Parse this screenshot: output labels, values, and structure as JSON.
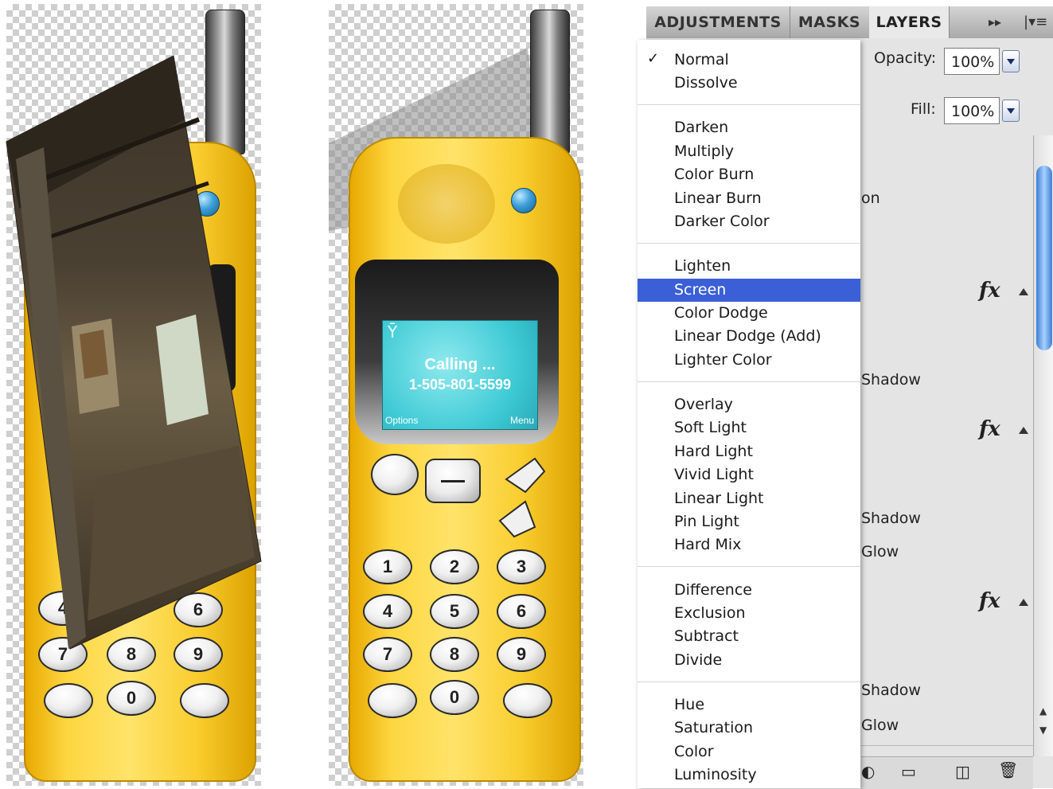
{
  "phone2": {
    "screen_status": "Calling ...",
    "screen_number": "1-505-801-5599",
    "softkey_left": "Options",
    "softkey_right": "Menu"
  },
  "keypad_labels": [
    "1",
    "2",
    "3",
    "4",
    "5",
    "6",
    "7",
    "8",
    "9",
    "0"
  ],
  "panel": {
    "tabs": [
      {
        "label": "ADJUSTMENTS",
        "active": false
      },
      {
        "label": "MASKS",
        "active": false
      },
      {
        "label": "LAYERS",
        "active": true
      }
    ],
    "opacity_label": "Opacity:",
    "opacity_value": "100%",
    "fill_label": "Fill:",
    "fill_value": "100%",
    "layer_fragments": [
      "on",
      "Shadow",
      "Shadow",
      "Glow",
      "Shadow",
      "Glow"
    ],
    "fx_label": "fx",
    "colors": {
      "selection": "#3a5fd6",
      "phone_yellow": "#fdd640",
      "screen": "#3cc9d4"
    }
  },
  "blend_menu": {
    "checkmark": "✓",
    "selected": "Screen",
    "items": [
      "Normal",
      "Dissolve",
      "Darken",
      "Multiply",
      "Color Burn",
      "Linear Burn",
      "Darker Color",
      "Lighten",
      "Screen",
      "Color Dodge",
      "Linear Dodge (Add)",
      "Lighter Color",
      "Overlay",
      "Soft Light",
      "Hard Light",
      "Vivid Light",
      "Linear Light",
      "Pin Light",
      "Hard Mix",
      "Difference",
      "Exclusion",
      "Subtract",
      "Divide",
      "Hue",
      "Saturation",
      "Color",
      "Luminosity"
    ]
  }
}
